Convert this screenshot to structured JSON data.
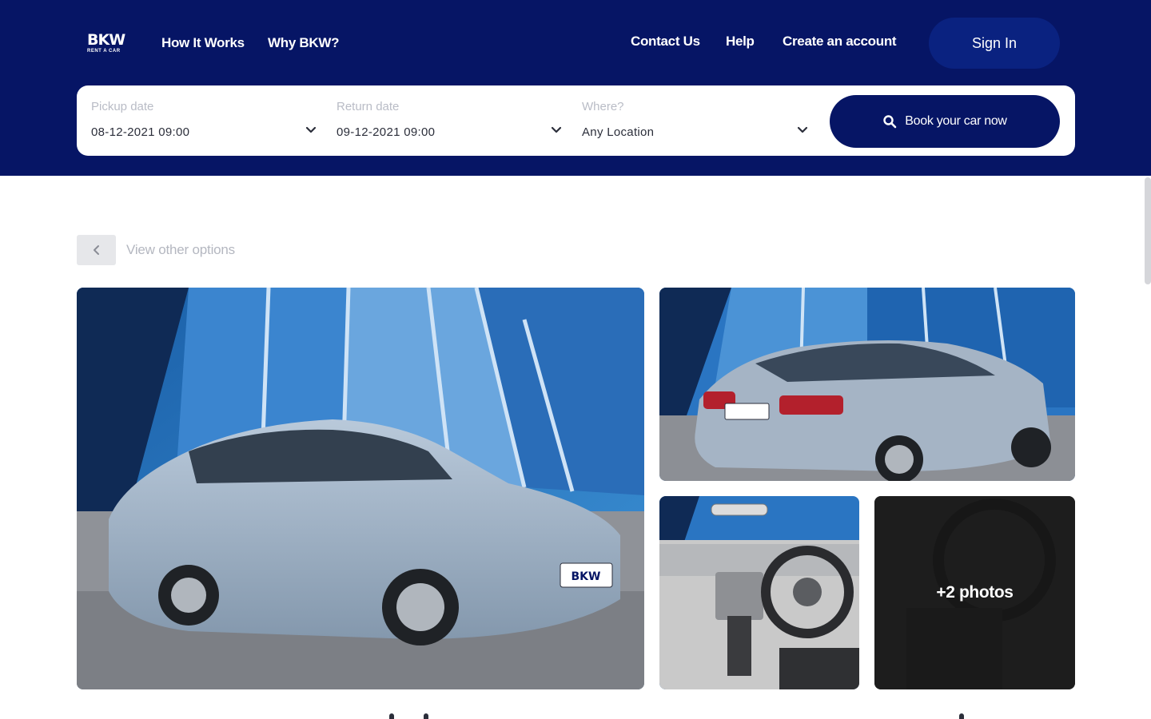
{
  "header": {
    "logo": {
      "main": "BKW",
      "tagline": "RENT A CAR"
    },
    "nav_left": [
      "How It Works",
      "Why BKW?"
    ],
    "nav_right": [
      "Contact Us",
      "Help",
      "Create an account"
    ],
    "signin_label": "Sign In"
  },
  "search": {
    "pickup": {
      "label": "Pickup date",
      "value": "08-12-2021 09:00"
    },
    "return": {
      "label": "Return date",
      "value": "09-12-2021 09:00"
    },
    "location": {
      "label": "Where?",
      "value": "Any Location"
    },
    "button_label": "Book your car now",
    "icons": {
      "chevron": "chevron-down-icon",
      "search": "search-icon"
    }
  },
  "listing": {
    "back_label": "View other options",
    "back_icon": "chevron-left-icon",
    "plate_text": "BKW",
    "more_photos_label": "+2 photos"
  },
  "colors": {
    "brand_navy": "#061565",
    "button_blue": "#0a2280",
    "car_silver": "#9fb0c2",
    "sky_blue": "#2f80c9"
  }
}
